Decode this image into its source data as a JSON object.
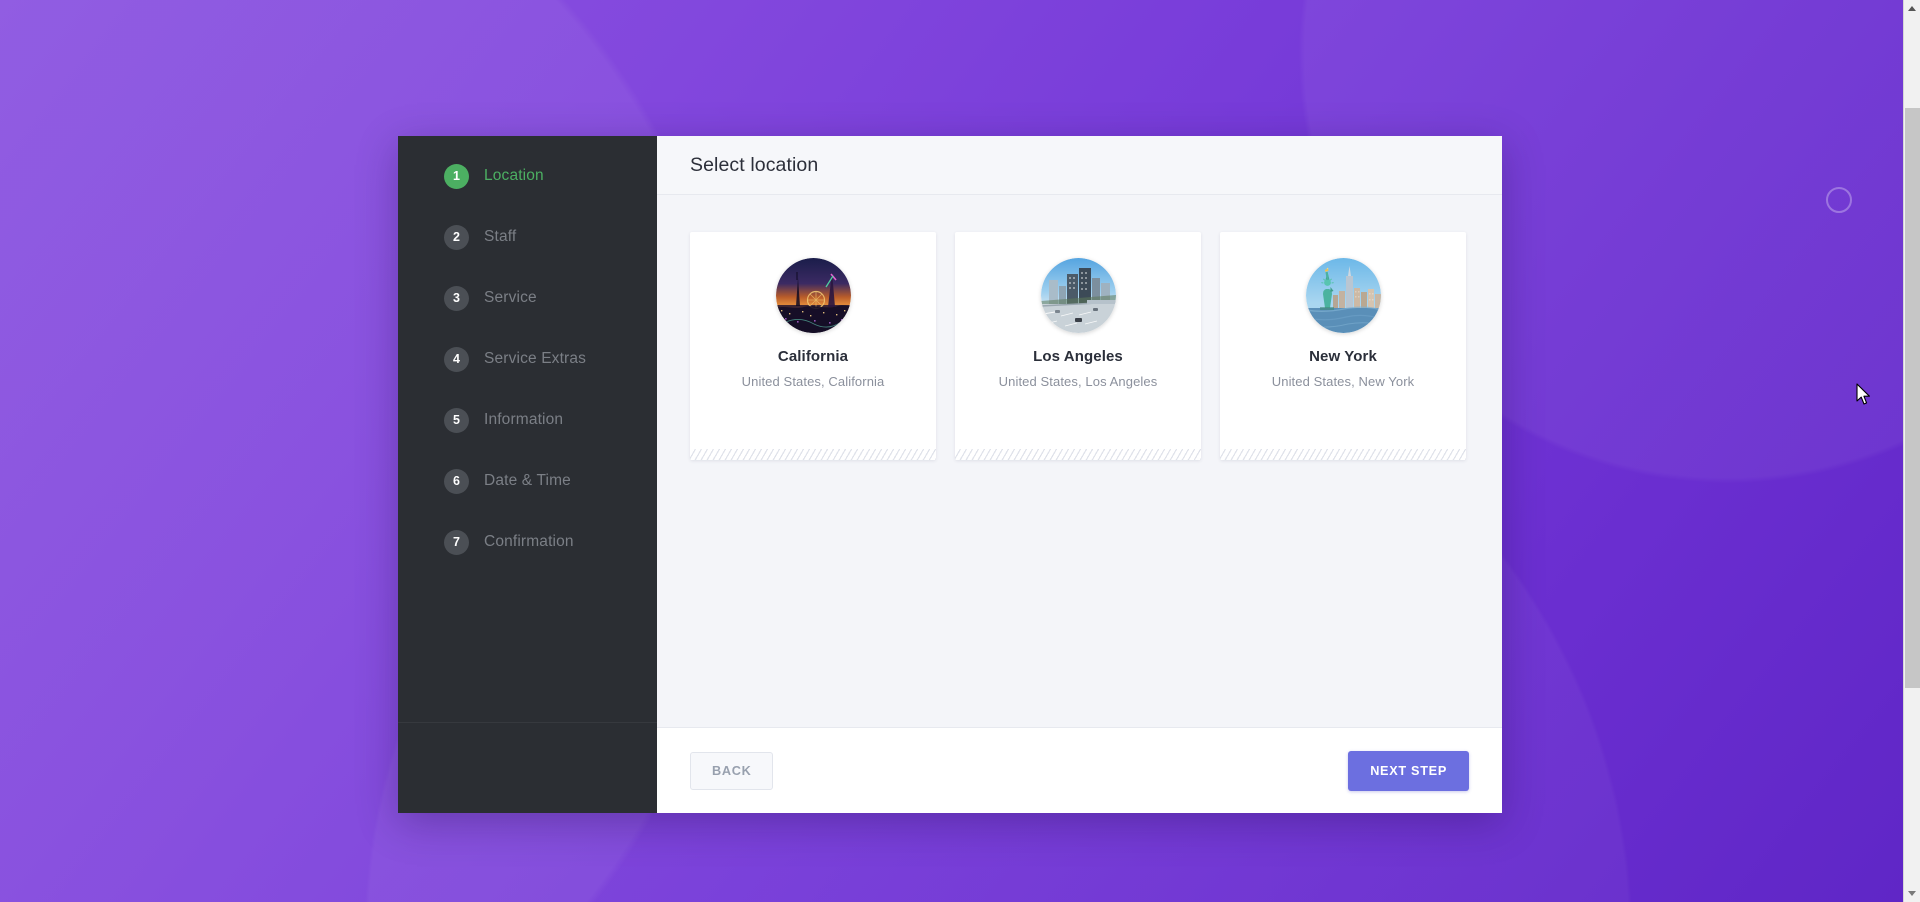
{
  "background": {
    "gradient_from": "#8b54e0",
    "gradient_to": "#5f26c6"
  },
  "wizard": {
    "sidebar": {
      "steps": [
        {
          "number": "1",
          "label": "Location",
          "state": "active"
        },
        {
          "number": "2",
          "label": "Staff",
          "state": "inactive"
        },
        {
          "number": "3",
          "label": "Service",
          "state": "inactive"
        },
        {
          "number": "4",
          "label": "Service Extras",
          "state": "inactive"
        },
        {
          "number": "5",
          "label": "Information",
          "state": "inactive"
        },
        {
          "number": "6",
          "label": "Date & Time",
          "state": "inactive"
        },
        {
          "number": "7",
          "label": "Confirmation",
          "state": "inactive"
        }
      ],
      "active_color": "#4caf62",
      "inactive_color": "#7b7f86",
      "background_color": "#2b2e33"
    },
    "header": {
      "title": "Select location"
    },
    "locations": [
      {
        "name": "California",
        "subtitle": "United States, California",
        "image": "california-sunset-fair-photo"
      },
      {
        "name": "Los Angeles",
        "subtitle": "United States, Los Angeles",
        "image": "los-angeles-freeway-skyline-photo"
      },
      {
        "name": "New York",
        "subtitle": "United States, New York",
        "image": "new-york-statue-of-liberty-photo"
      }
    ],
    "footer": {
      "back_label": "BACK",
      "next_label": "NEXT STEP",
      "next_color": "#6c6fe0"
    }
  }
}
